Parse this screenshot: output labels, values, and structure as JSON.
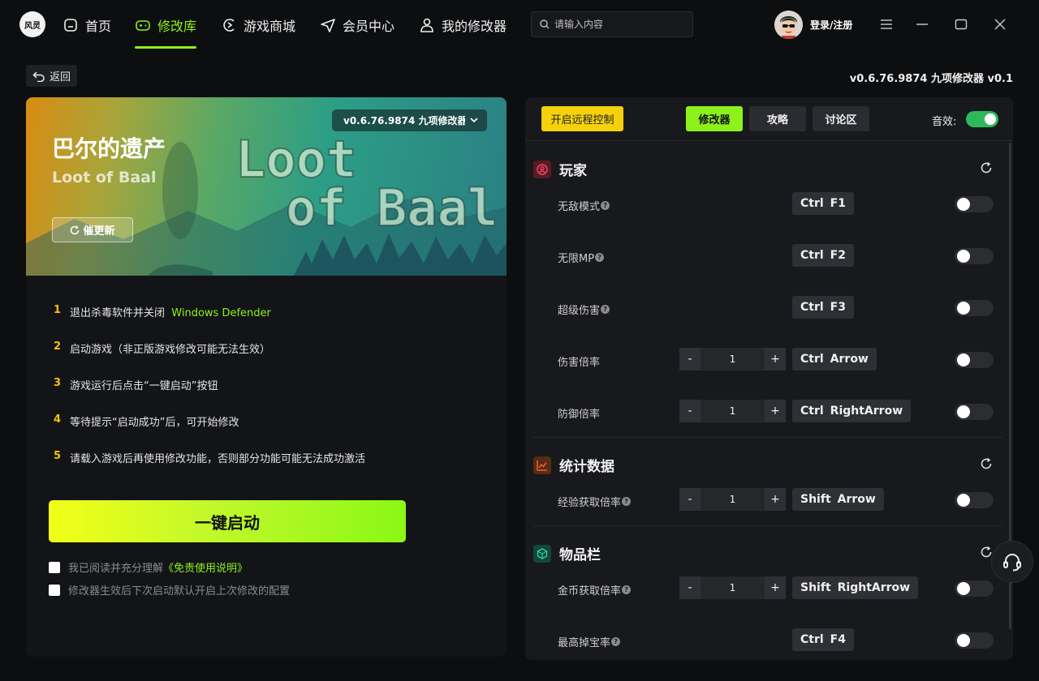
{
  "app": {
    "logo_text": "风灵",
    "nav": [
      {
        "label": "首页",
        "icon": "home-icon",
        "active": false
      },
      {
        "label": "修改库",
        "icon": "gamepad-icon",
        "active": true
      },
      {
        "label": "游戏商城",
        "icon": "store-icon",
        "active": false
      },
      {
        "label": "会员中心",
        "icon": "send-icon",
        "active": false
      },
      {
        "label": "我的修改器",
        "icon": "user-icon",
        "active": false
      }
    ],
    "search": {
      "placeholder": "请输入内容",
      "value": ""
    },
    "login_label": "登录/注册"
  },
  "page": {
    "back_label": "返回",
    "version_top": "v0.6.76.9874 九项修改器 v0.1"
  },
  "game": {
    "title": "巴尔的遗产",
    "subtitle": "Loot of Baal",
    "update_label": "催更新",
    "version_select": "v0.6.76.9874 九项修改器 v0.1",
    "logo_line1": "Loot",
    "logo_line2": "of Baal"
  },
  "steps": [
    {
      "num": "1",
      "text": "退出杀毒软件并关闭",
      "highlight": "Windows Defender"
    },
    {
      "num": "2",
      "text": "启动游戏（非正版游戏修改可能无法生效）",
      "highlight": ""
    },
    {
      "num": "3",
      "text": "游戏运行后点击“一键启动”按钮",
      "highlight": ""
    },
    {
      "num": "4",
      "text": "等待提示“启动成功”后，可开始修改",
      "highlight": ""
    },
    {
      "num": "5",
      "text": "请载入游戏后再使用修改功能，否则部分功能可能无法成功激活",
      "highlight": ""
    }
  ],
  "launch_label": "一键启动",
  "checks": [
    {
      "text": "我已阅读并充分理解",
      "link": "《免责使用说明》"
    },
    {
      "text": "修改器生效后下次启动默认开启上次修改的配置",
      "link": ""
    }
  ],
  "panel": {
    "remote_label": "开启远程控制",
    "tabs": [
      "修改器",
      "攻略",
      "讨论区"
    ],
    "sound_label": "音效:",
    "sound_on": true
  },
  "sections": [
    {
      "title": "玩家",
      "rows": [
        {
          "label": "无敌模式",
          "help": true,
          "keys": [
            "Ctrl",
            "F1"
          ],
          "stepper": null
        },
        {
          "label": "无限MP",
          "help": true,
          "keys": [
            "Ctrl",
            "F2"
          ],
          "stepper": null
        },
        {
          "label": "超级伤害",
          "help": true,
          "keys": [
            "Ctrl",
            "F3"
          ],
          "stepper": null
        },
        {
          "label": "伤害倍率",
          "help": false,
          "keys": [
            "Ctrl",
            "Arrow"
          ],
          "stepper": "1"
        },
        {
          "label": "防御倍率",
          "help": false,
          "keys": [
            "Ctrl",
            "RightArrow"
          ],
          "stepper": "1"
        }
      ]
    },
    {
      "title": "统计数据",
      "rows": [
        {
          "label": "经验获取倍率",
          "help": true,
          "keys": [
            "Shift",
            "Arrow"
          ],
          "stepper": "1"
        }
      ]
    },
    {
      "title": "物品栏",
      "rows": [
        {
          "label": "金币获取倍率",
          "help": true,
          "keys": [
            "Shift",
            "RightArrow"
          ],
          "stepper": "1"
        },
        {
          "label": "最高掉宝率",
          "help": true,
          "keys": [
            "Ctrl",
            "F4"
          ],
          "stepper": null
        }
      ]
    }
  ],
  "stepper_minus": "-",
  "stepper_plus": "+",
  "help_glyph": "?",
  "colors": {
    "accent": "#8df21b",
    "remote": "#f5d10b",
    "step_num": "#f1c40f"
  }
}
